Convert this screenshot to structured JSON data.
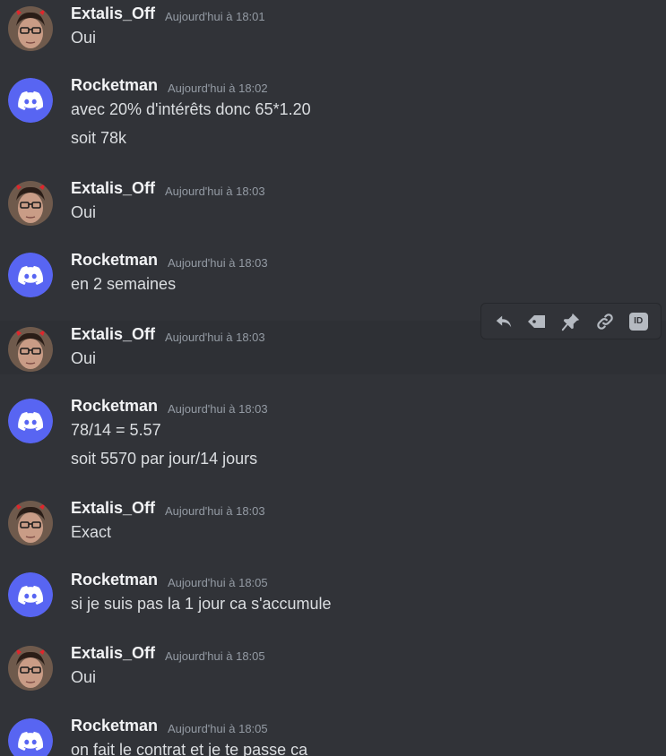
{
  "messages": [
    {
      "author": "Extalis_Off",
      "avatar": "extalis",
      "timestamp": "Aujourd'hui à 18:01",
      "lines": [
        "Oui"
      ]
    },
    {
      "author": "Rocketman",
      "avatar": "discord",
      "timestamp": "Aujourd'hui à 18:02",
      "lines": [
        "avec 20% d'intérêts donc 65*1.20",
        "soit 78k"
      ]
    },
    {
      "author": "Extalis_Off",
      "avatar": "extalis",
      "timestamp": "Aujourd'hui à 18:03",
      "lines": [
        "Oui"
      ]
    },
    {
      "author": "Rocketman",
      "avatar": "discord",
      "timestamp": "Aujourd'hui à 18:03",
      "lines": [
        "en 2 semaines"
      ]
    },
    {
      "author": "Extalis_Off",
      "avatar": "extalis",
      "timestamp": "Aujourd'hui à 18:03",
      "lines": [
        "Oui"
      ],
      "hovered": true
    },
    {
      "author": "Rocketman",
      "avatar": "discord",
      "timestamp": "Aujourd'hui à 18:03",
      "lines": [
        "78/14 = 5.57",
        "soit 5570 par jour/14 jours"
      ]
    },
    {
      "author": "Extalis_Off",
      "avatar": "extalis",
      "timestamp": "Aujourd'hui à 18:03",
      "lines": [
        "Exact"
      ]
    },
    {
      "author": "Rocketman",
      "avatar": "discord",
      "timestamp": "Aujourd'hui à 18:05",
      "lines": [
        "si je suis pas la 1 jour ca s'accumule"
      ]
    },
    {
      "author": "Extalis_Off",
      "avatar": "extalis",
      "timestamp": "Aujourd'hui à 18:05",
      "lines": [
        "Oui"
      ]
    },
    {
      "author": "Rocketman",
      "avatar": "discord",
      "timestamp": "Aujourd'hui à 18:05",
      "lines": [
        "on fait le contrat et je te passe ca"
      ]
    }
  ],
  "toolbar": {
    "actions": [
      {
        "name": "reply-icon"
      },
      {
        "name": "tag-icon"
      },
      {
        "name": "pin-icon"
      },
      {
        "name": "link-icon"
      },
      {
        "name": "copy-id-icon",
        "label": "ID"
      }
    ]
  },
  "colors": {
    "background": "#313338",
    "hover_background": "#2e3035",
    "username": "#f2f3f5",
    "message_text": "#dbdee1",
    "timestamp": "#949ba4",
    "discord_blurple": "#5865f2",
    "icon": "#b5bac1"
  }
}
